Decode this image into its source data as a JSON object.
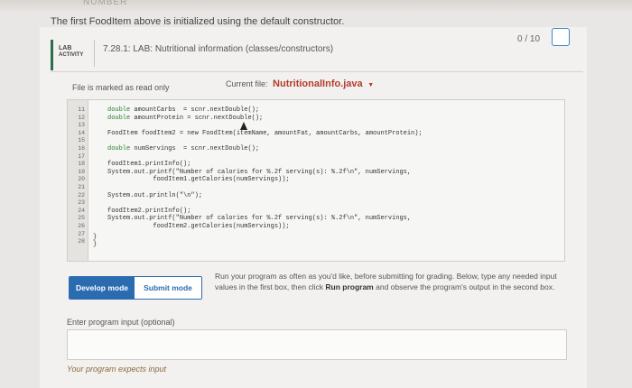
{
  "page": {
    "top_strip": "NUMBER",
    "intro": "The first FoodItem above is initialized using the default constructor."
  },
  "activity": {
    "badge_line1": "LAB",
    "badge_line2": "ACTIVITY",
    "title": "7.28.1: LAB: Nutritional information (classes/constructors)",
    "score": "0 / 10"
  },
  "editor": {
    "readonly_notice": "File is marked as read only",
    "current_file_label": "Current file:",
    "current_file": "NutritionalInfo.java",
    "line_numbers": [
      "11",
      "12",
      "13",
      "14",
      "15",
      "16",
      "17",
      "18",
      "19",
      "20",
      "21",
      "22",
      "23",
      "24",
      "25",
      "26",
      "27",
      "28"
    ],
    "lines": [
      {
        "kw": "double",
        "rest": " amountCarbs  = scnr.nextDouble();"
      },
      {
        "kw": "double",
        "rest": " amountProtein = scnr.nextDouble();"
      },
      {
        "kw": "",
        "rest": ""
      },
      {
        "kw": "",
        "rest": "FoodItem foodItem2 = new FoodItem(itemName, amountFat, amountCarbs, amountProtein);"
      },
      {
        "kw": "",
        "rest": ""
      },
      {
        "kw": "double",
        "rest": " numServings  = scnr.nextDouble();"
      },
      {
        "kw": "",
        "rest": ""
      },
      {
        "kw": "",
        "rest": "foodItem1.printInfo();"
      },
      {
        "kw": "",
        "rest": "System.out.printf(\"Number of calories for %.2f serving(s): %.2f\\n\", numServings,"
      },
      {
        "kw": "",
        "rest": "            foodItem1.getCalories(numServings));"
      },
      {
        "kw": "",
        "rest": ""
      },
      {
        "kw": "",
        "rest": "System.out.println(\"\\n\");"
      },
      {
        "kw": "",
        "rest": ""
      },
      {
        "kw": "",
        "rest": "foodItem2.printInfo();"
      },
      {
        "kw": "",
        "rest": "System.out.printf(\"Number of calories for %.2f serving(s): %.2f\\n\", numServings,"
      },
      {
        "kw": "",
        "rest": "            foodItem2.getCalories(numServings));"
      },
      {
        "kw": "",
        "rest": ""
      },
      {
        "kw": "",
        "rest": ""
      }
    ],
    "brace_27": "}",
    "brace_28": "}"
  },
  "controls": {
    "develop_mode": "Develop mode",
    "submit_mode": "Submit mode",
    "help_part1": "Run your program as often as you'd like, before submitting for grading. Below, type any needed input values in the first box, then click ",
    "help_bold": "Run program",
    "help_part2": " and observe the program's output in the second box."
  },
  "input": {
    "label": "Enter program input (optional)",
    "value": "",
    "expects": "Your program expects input"
  },
  "colors": {
    "accent_blue": "#2b6cb0",
    "file_name_red": "#b43b2c",
    "lab_green": "#2d6e4a",
    "keyword_green": "#2a7d34"
  }
}
